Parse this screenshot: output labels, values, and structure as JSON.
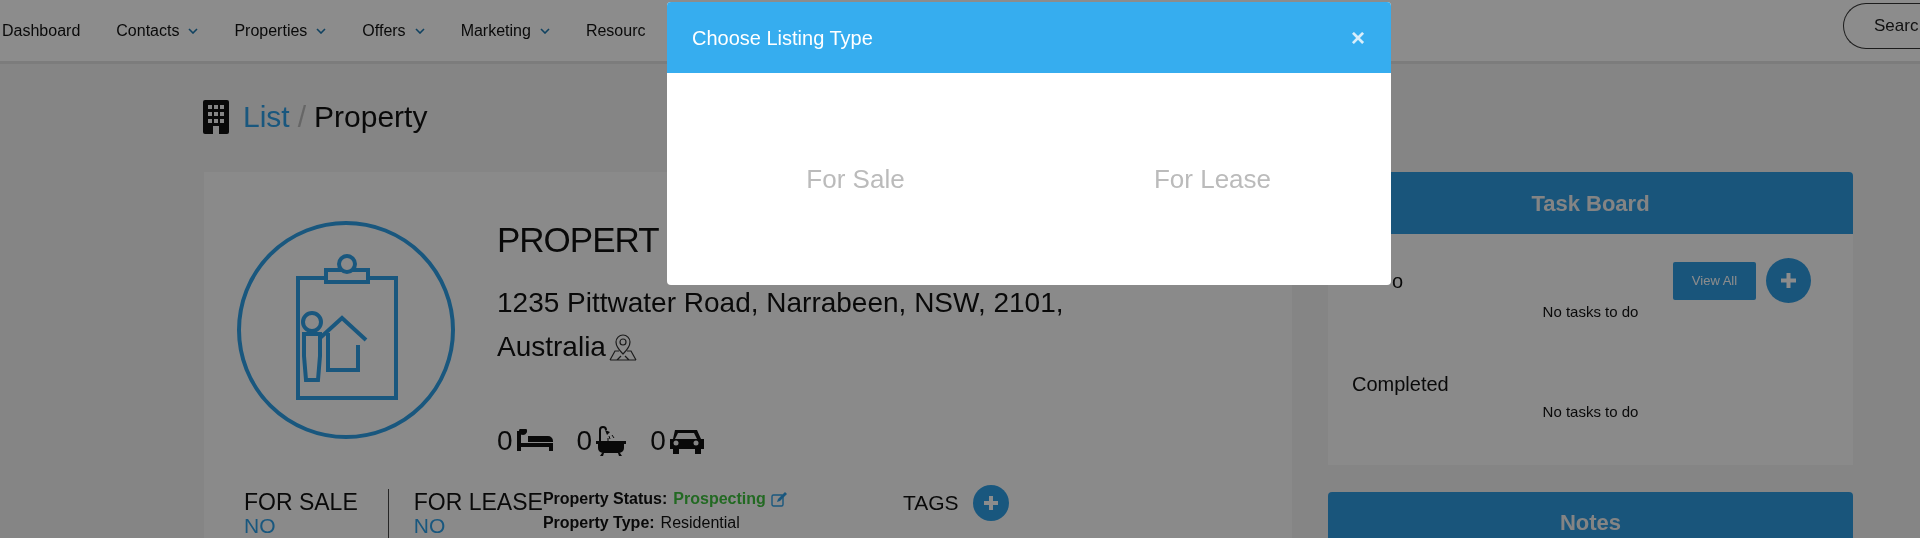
{
  "nav": {
    "items": [
      {
        "label": "Dashboard",
        "dropdown": false
      },
      {
        "label": "Contacts",
        "dropdown": true
      },
      {
        "label": "Properties",
        "dropdown": true
      },
      {
        "label": "Offers",
        "dropdown": true
      },
      {
        "label": "Marketing",
        "dropdown": true
      },
      {
        "label": "Resourc",
        "dropdown": false
      }
    ],
    "search": {
      "placeholder": "Searc"
    }
  },
  "breadcrumb": {
    "parent": "List",
    "separator": "/",
    "current": "Property"
  },
  "property": {
    "title": "PROPERT",
    "address_line1": "1235 Pittwater Road, Narrabeen, NSW, 2101,",
    "address_line2": "Australia",
    "counts": [
      {
        "kind": "bed",
        "value": "0"
      },
      {
        "kind": "bath",
        "value": "0"
      },
      {
        "kind": "car",
        "value": "0"
      }
    ],
    "listing": [
      {
        "label": "FOR SALE",
        "value": "NO"
      },
      {
        "label": "FOR LEASE",
        "value": "NO"
      }
    ],
    "details": [
      {
        "kind": "status",
        "label": "Property Status:",
        "value": "Prospecting"
      },
      {
        "kind": "plain",
        "label": "Property Type:",
        "value": "Residential"
      }
    ],
    "tags_label": "TAGS"
  },
  "task_board": {
    "title": "Task Board",
    "view_all": "View All",
    "sections": [
      {
        "title": "o",
        "empty_text": "No tasks to do",
        "actions": true
      },
      {
        "title": "Completed",
        "empty_text": "No tasks to do",
        "actions": false
      }
    ]
  },
  "notes": {
    "title": "Notes"
  },
  "modal": {
    "title": "Choose Listing Type",
    "close": "×",
    "options": [
      "For Sale",
      "For Lease"
    ]
  }
}
